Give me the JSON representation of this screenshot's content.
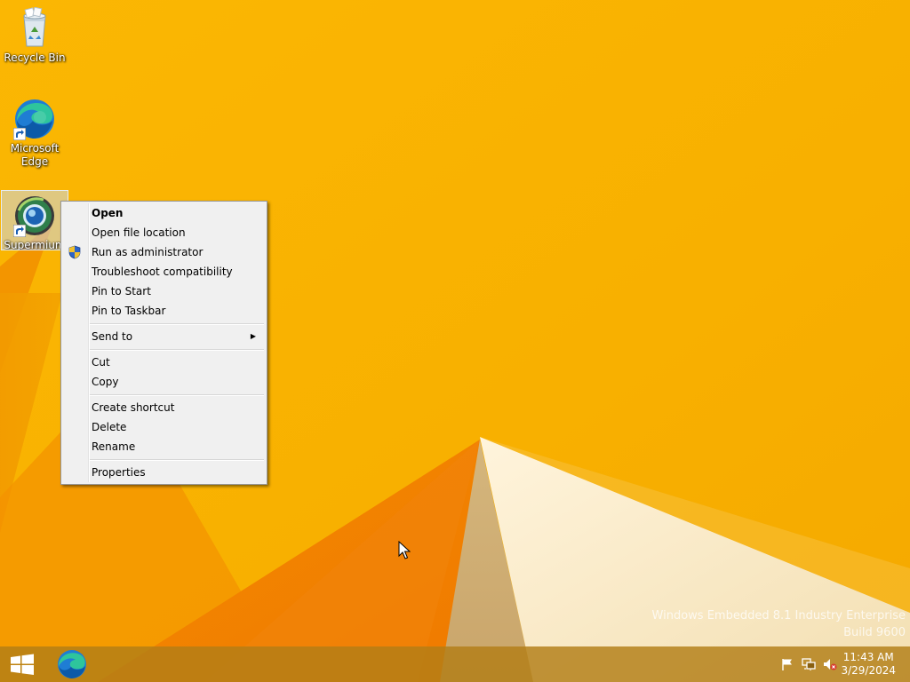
{
  "desktop": {
    "icons": [
      {
        "label": "Recycle Bin",
        "icon": "recycle-bin-icon"
      },
      {
        "label": "Microsoft Edge",
        "icon": "edge-icon"
      },
      {
        "label": "Supermium",
        "icon": "supermium-icon"
      }
    ]
  },
  "context_menu": {
    "items": {
      "open": "Open",
      "open_file_location": "Open file location",
      "run_as_admin": "Run as administrator",
      "troubleshoot": "Troubleshoot compatibility",
      "pin_start": "Pin to Start",
      "pin_taskbar": "Pin to Taskbar",
      "send_to": "Send to",
      "cut": "Cut",
      "copy": "Copy",
      "create_shortcut": "Create shortcut",
      "delete": "Delete",
      "rename": "Rename",
      "properties": "Properties"
    }
  },
  "watermark": {
    "line1": "Windows Embedded 8.1 Industry Enterprise",
    "line2": "Build 9600"
  },
  "taskbar": {
    "clock_time": "11:43 AM",
    "clock_date": "3/29/2024"
  },
  "colors": {
    "wallpaper": "#f6b100",
    "taskbar": "#b27e16",
    "menu_bg": "#f0f0f0"
  }
}
